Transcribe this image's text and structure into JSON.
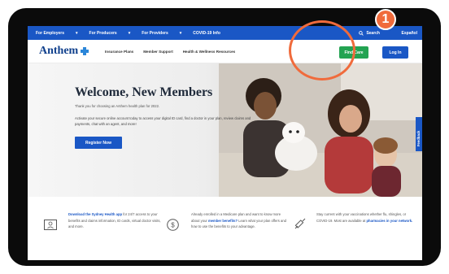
{
  "topbar": {
    "items": [
      "For Employers",
      "For Producers",
      "For Providers",
      "COVID-19 Info"
    ],
    "search": "Search",
    "language": "Español"
  },
  "header": {
    "logo_text": "Anthem",
    "nav": [
      "Insurance Plans",
      "Member Support",
      "Health & Wellness Resources"
    ],
    "find_care": "Find Care",
    "login": "Log In"
  },
  "hero": {
    "title": "Welcome, New Members",
    "thanks": "Thank you for choosing an Anthem health plan for 2022.",
    "body": "Activate your secure online account today to access your digital ID card, find a doctor in your plan, review claims and payments, chat with an agent, and more!",
    "register": "Register Now"
  },
  "feedback": "Feedback",
  "info": [
    {
      "link": "Download the Sydney Health app",
      "text": " for 24/7 access to your benefits and claims information, ID cards, virtual doctor visits, and more."
    },
    {
      "text": "Already enrolled in a Medicare plan and want to know more about your ",
      "link": "member benefits?",
      "text2": " Learn what your plan offers and how to use the benefits to your advantage."
    },
    {
      "text": "Stay current with your vaccinations whether flu, shingles, or COVID-19. Most are available at ",
      "link": "pharmacies in your network."
    }
  ],
  "annotation": {
    "number": "1",
    "color": "#f06b3c"
  },
  "colors": {
    "brand_blue": "#1a57c5",
    "find_care_green": "#23a352",
    "logo_blue": "#0f3f8c"
  }
}
